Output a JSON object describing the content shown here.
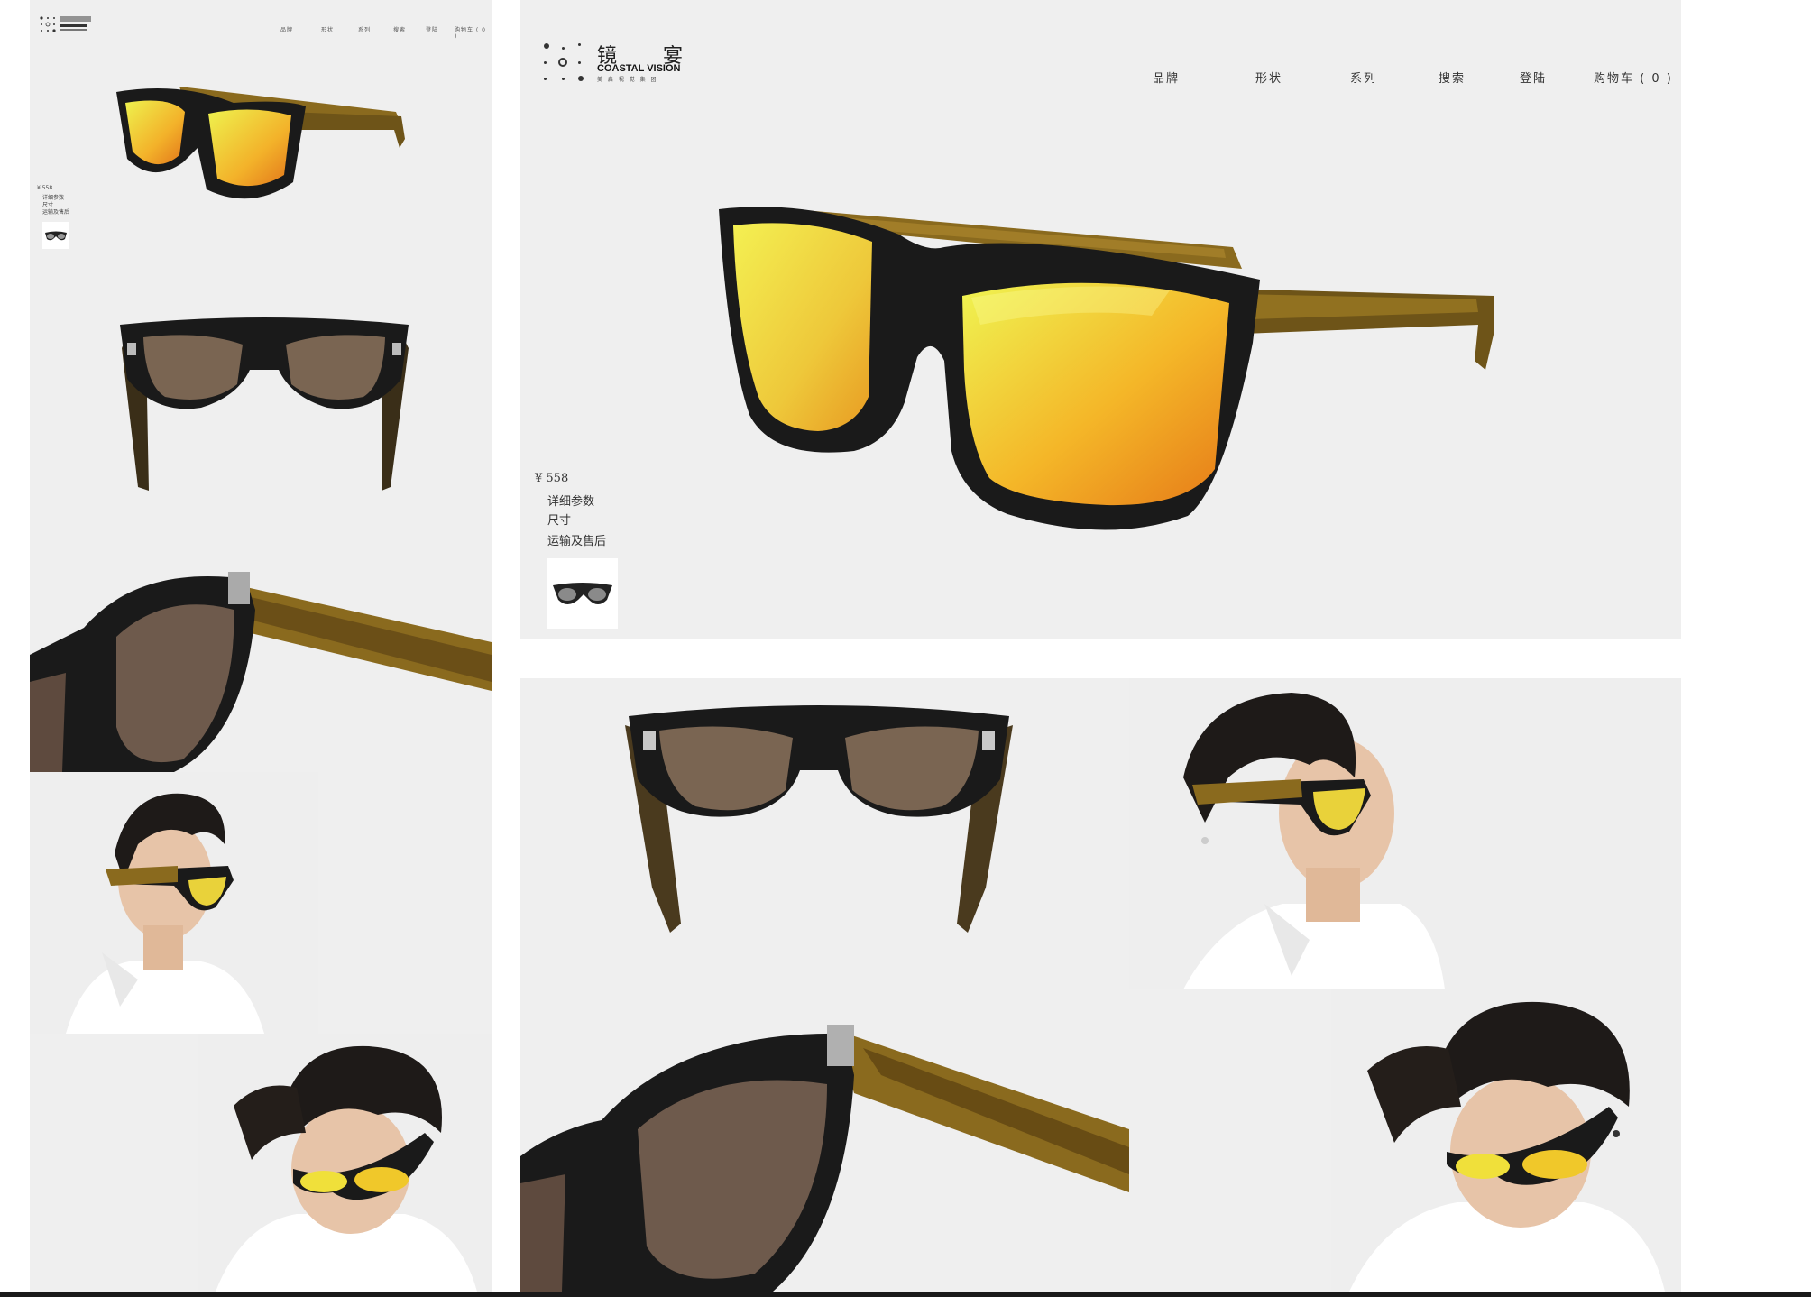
{
  "brand": {
    "name_cn": "镜 宴",
    "name_en": "COASTAL VISION",
    "tagline": "美 启 视 觉 集 团"
  },
  "nav": [
    {
      "label": "品牌"
    },
    {
      "label": "形状"
    },
    {
      "label": "系列"
    },
    {
      "label": "搜索"
    },
    {
      "label": "登陆"
    },
    {
      "label": "购物车 ( 0 )"
    }
  ],
  "mini_nav": [
    {
      "label": "品牌"
    },
    {
      "label": "形状"
    },
    {
      "label": "系列"
    },
    {
      "label": "搜索"
    },
    {
      "label": "登陆"
    },
    {
      "label": "购物车 ( 0 )"
    }
  ],
  "product": {
    "price": "¥  558",
    "links": [
      {
        "label": "详细参数"
      },
      {
        "label": "尺寸"
      },
      {
        "label": "运输及售后"
      }
    ]
  },
  "colors": {
    "panel_bg": "#efefef",
    "frame": "#1a1a1a",
    "lens_mirror_top": "#e8f04a",
    "lens_mirror_bottom": "#e8921a",
    "lens_brown": "#7a6552",
    "tortoise": "#8a6a1e"
  }
}
